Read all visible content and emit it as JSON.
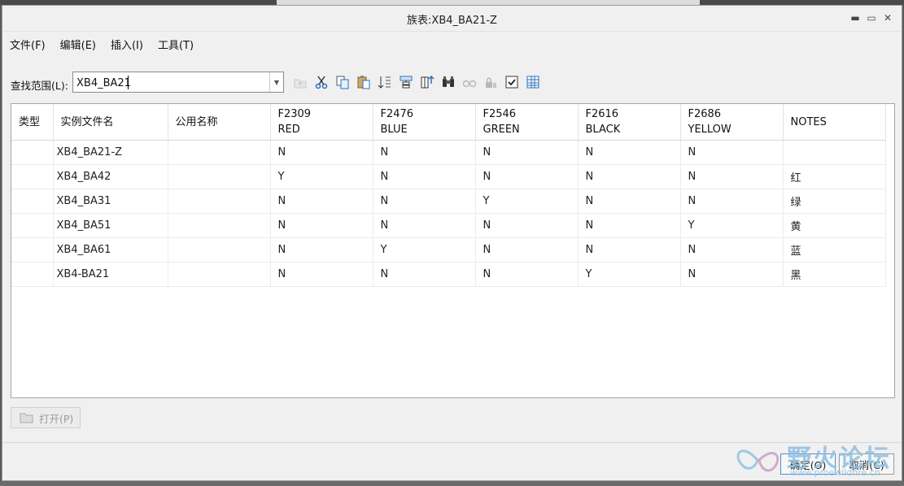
{
  "window": {
    "title": "族表:XB4_BA21-Z",
    "controls": [
      "▬",
      "▭",
      "✕"
    ]
  },
  "menubar": [
    {
      "label": "文件(F)"
    },
    {
      "label": "编辑(E)"
    },
    {
      "label": "插入(I)"
    },
    {
      "label": "工具(T)"
    }
  ],
  "search": {
    "label": "查找范围(L):",
    "value": "XB4_BA21"
  },
  "toolbar": [
    {
      "icon": "go-up-icon",
      "enabled": false
    },
    {
      "icon": "cut-icon",
      "enabled": true
    },
    {
      "icon": "copy-icon",
      "enabled": true
    },
    {
      "icon": "paste-icon",
      "enabled": true
    },
    {
      "icon": "sort-icon",
      "enabled": true
    },
    {
      "icon": "add-column-icon",
      "enabled": true
    },
    {
      "icon": "add-row-icon",
      "enabled": true
    },
    {
      "icon": "binoculars-find-icon",
      "enabled": true
    },
    {
      "icon": "glasses-preview-icon",
      "enabled": false
    },
    {
      "icon": "lock-icon",
      "enabled": false
    },
    {
      "icon": "verify-checkbox-icon",
      "enabled": true
    },
    {
      "icon": "table-icon",
      "enabled": true
    }
  ],
  "table": {
    "headers": [
      {
        "line1": "类型",
        "line2": ""
      },
      {
        "line1": "实例文件名",
        "line2": ""
      },
      {
        "line1": "公用名称",
        "line2": ""
      },
      {
        "line1": "F2309",
        "line2": "RED"
      },
      {
        "line1": "F2476",
        "line2": "BLUE"
      },
      {
        "line1": "F2546",
        "line2": "GREEN"
      },
      {
        "line1": "F2616",
        "line2": "BLACK"
      },
      {
        "line1": "F2686",
        "line2": "YELLOW"
      },
      {
        "line1": "NOTES",
        "line2": ""
      }
    ],
    "rows": [
      [
        "",
        "XB4_BA21-Z",
        "",
        "N",
        "N",
        "N",
        "N",
        "N",
        ""
      ],
      [
        "",
        "XB4_BA42",
        "",
        "Y",
        "N",
        "N",
        "N",
        "N",
        "红"
      ],
      [
        "",
        "XB4_BA31",
        "",
        "N",
        "N",
        "Y",
        "N",
        "N",
        "绿"
      ],
      [
        "",
        "XB4_BA51",
        "",
        "N",
        "N",
        "N",
        "N",
        "Y",
        "黄"
      ],
      [
        "",
        "XB4_BA61",
        "",
        "N",
        "Y",
        "N",
        "N",
        "N",
        "蓝"
      ],
      [
        "",
        "XB4-BA21",
        "",
        "N",
        "N",
        "N",
        "Y",
        "N",
        "黑"
      ]
    ]
  },
  "buttons": {
    "open": "打开(P)",
    "ok": "确定(O)",
    "cancel": "取消(C)"
  },
  "watermark": {
    "text": "野火论坛",
    "url": "www.proewildfire.cn"
  },
  "colors": {
    "ok_border": "#5b8ad8",
    "watermark": "#8cbee1"
  }
}
